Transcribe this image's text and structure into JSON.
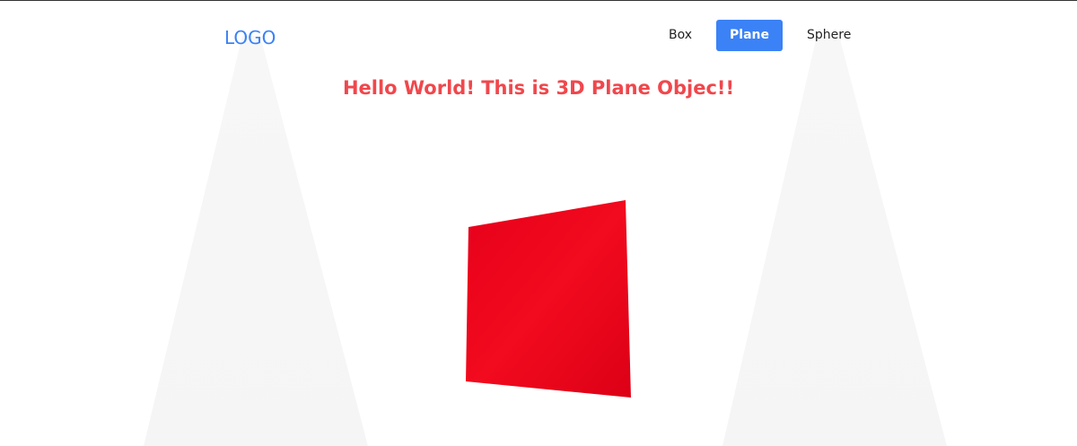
{
  "header": {
    "logo": "LOGO",
    "nav": [
      {
        "label": "Box",
        "active": false
      },
      {
        "label": "Plane",
        "active": true
      },
      {
        "label": "Sphere",
        "active": false
      }
    ]
  },
  "main": {
    "heading": "Hello World! This is 3D Plane Objec!!"
  },
  "colors": {
    "accent": "#3b82f6",
    "heading": "#f0474c",
    "plane": "#e8001a"
  }
}
